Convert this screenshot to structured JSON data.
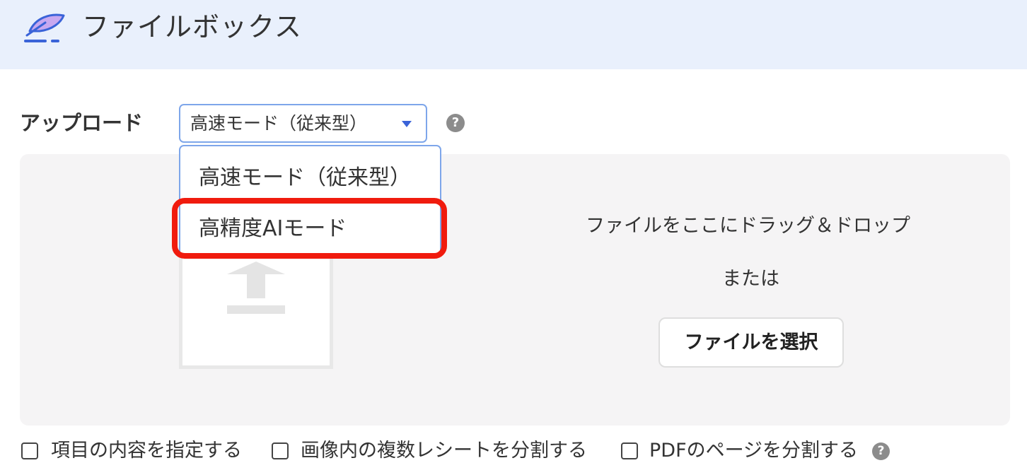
{
  "header": {
    "title": "ファイルボックス",
    "logo_icon": "feather-pen-icon"
  },
  "upload": {
    "label": "アップロード",
    "mode_select": {
      "selected": "高速モード（従来型）",
      "options": [
        "高速モード（従来型）",
        "高精度AIモード"
      ]
    },
    "help_icon": "question-icon"
  },
  "dropzone": {
    "drop_text": "ファイルをここにドラッグ＆ドロップ",
    "or_text": "または",
    "choose_button": "ファイルを選択",
    "upload_icon": "upload-arrow-icon"
  },
  "options": [
    "項目の内容を指定する",
    "画像内の複数レシートを分割する",
    "PDFのページを分割する"
  ],
  "colors": {
    "header_bg": "#e9f0fc",
    "accent": "#3a63d8",
    "highlight": "#f01b0e"
  }
}
